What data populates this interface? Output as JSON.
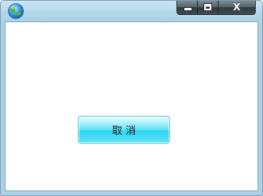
{
  "window": {
    "icon": "globe-icon",
    "controls": {
      "minimize_icon": "minimize-icon",
      "maximize_icon": "maximize-icon",
      "close_icon": "close-icon",
      "close_glyph": "X"
    }
  },
  "dialog": {
    "cancel_label": "取消"
  },
  "colors": {
    "frame": "#a9d2e6",
    "client_background": "#ffffff",
    "button_accent": "#2ed4f0",
    "caption_buttons": "#3e4c53"
  }
}
